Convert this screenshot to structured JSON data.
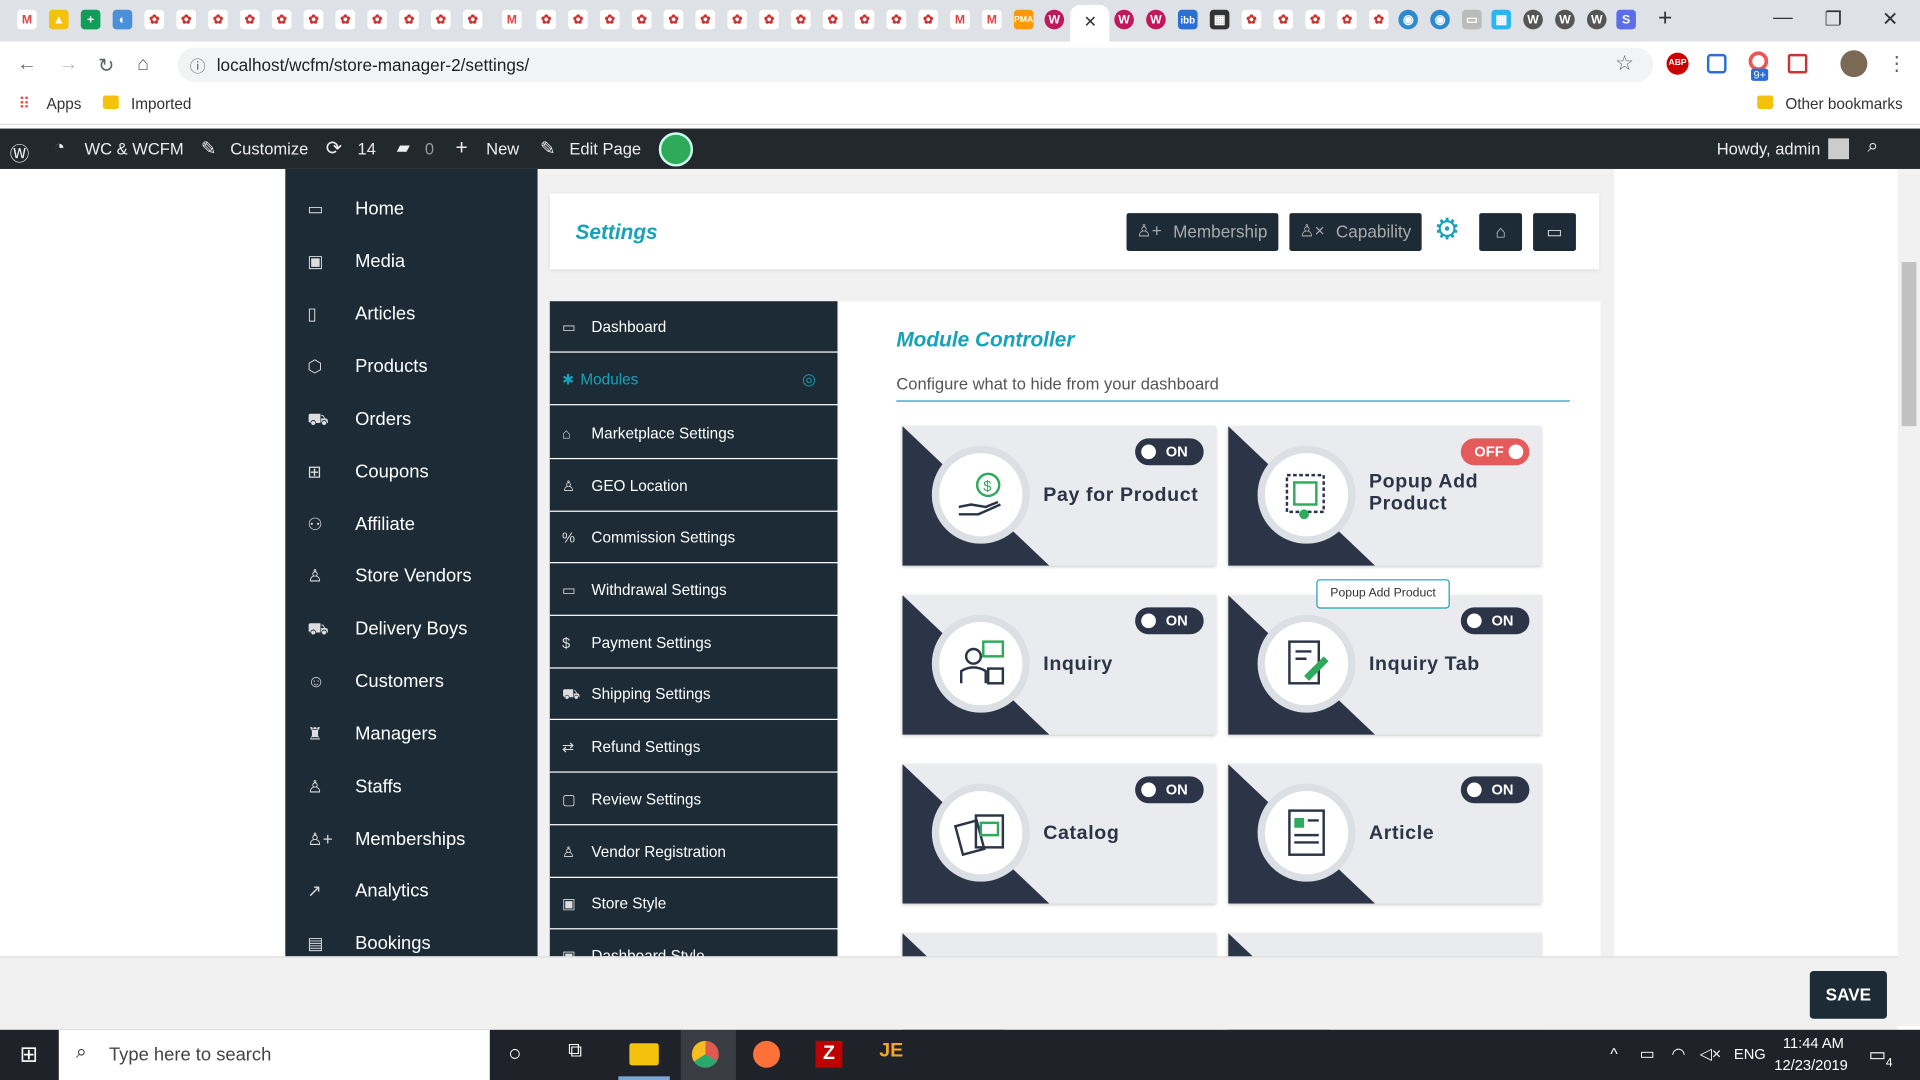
{
  "browser": {
    "url": "localhost/wcfm/store-manager-2/settings/",
    "bookmarks": [
      "Apps",
      "Imported"
    ],
    "other_bookmarks": "Other bookmarks",
    "ext_badge": "9+"
  },
  "wpbar": {
    "site": "WC & WCFM",
    "customize": "Customize",
    "updates": "14",
    "comments": "0",
    "new": "New",
    "edit": "Edit Page",
    "howdy": "Howdy, admin"
  },
  "left_nav": [
    "Home",
    "Media",
    "Articles",
    "Products",
    "Orders",
    "Coupons",
    "Affiliate",
    "Store Vendors",
    "Delivery Boys",
    "Customers",
    "Managers",
    "Staffs",
    "Memberships",
    "Analytics",
    "Bookings"
  ],
  "header": {
    "title": "Settings",
    "membership": "Membership",
    "capability": "Capability"
  },
  "settings_nav": [
    "Dashboard",
    "Modules",
    "Marketplace Settings",
    "GEO Location",
    "Commission Settings",
    "Withdrawal Settings",
    "Payment Settings",
    "Shipping Settings",
    "Refund Settings",
    "Review Settings",
    "Vendor Registration",
    "Store Style",
    "Dashboard Style"
  ],
  "module": {
    "title": "Module Controller",
    "subtitle": "Configure what to hide from your dashboard"
  },
  "cards": [
    {
      "name": "Pay for Product",
      "state": "ON"
    },
    {
      "name": "Popup Add Product",
      "state": "OFF"
    },
    {
      "name": "Inquiry",
      "state": "ON"
    },
    {
      "name": "Inquiry Tab",
      "state": "ON"
    },
    {
      "name": "Catalog",
      "state": "ON"
    },
    {
      "name": "Article",
      "state": "ON"
    }
  ],
  "tooltip": "Popup Add Product",
  "save": "SAVE",
  "taskbar": {
    "search": "Type here to search",
    "time": "11:44 AM",
    "date": "12/23/2019",
    "lang": "ENG",
    "notif": "4"
  },
  "colors": {
    "accent": "#17a2b8",
    "dark": "#1c2b36",
    "off": "#e55b5b"
  }
}
